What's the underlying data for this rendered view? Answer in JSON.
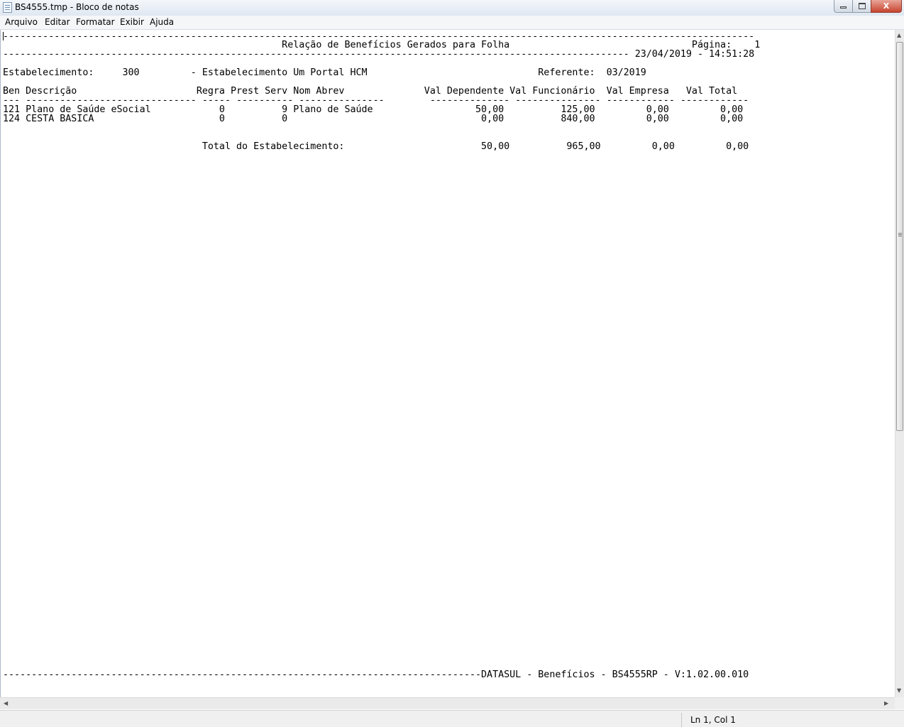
{
  "window": {
    "title": "BS4555.tmp - Bloco de notas",
    "minimize_glyph": "",
    "maximize_glyph": "",
    "close_glyph": "X"
  },
  "menu": [
    "Arquivo",
    "Editar",
    "Formatar",
    "Exibir",
    "Ajuda"
  ],
  "document": {
    "lines": [
      "------------------------------------------------------------------------------------------------------------------------------------",
      "                                                 Relação de Benefícios Gerados para Folha                                Página:    1",
      "-------------------------------------------------------------------------------------------------------------- 23/04/2019 - 14:51:28",
      "Estabelecimento:     300         - Estabelecimento Um Portal HCM                              Referente:  03/2019",
      "Ben Descrição                     Regra Prest Serv Nom Abrev              Val Dependente Val Funcionário  Val Empresa   Val Total",
      "--- ------------------------------ ----- ---------- ---------------        -------------- --------------- ------------ ------------",
      "121 Plano de Saúde eSocial            0          9 Plano de Saúde                  50,00          125,00         0,00         0,00",
      "124 CESTA BASICA                      0          0                                  0,00          840,00         0,00         0,00",
      "                                   Total do Estabelecimento:                        50,00          965,00         0,00         0,00",
      "------------------------------------------------------------------------------------DATASUL - Benefícios - BS4555RP - V:1.02.00.010"
    ]
  },
  "status": {
    "position": "Ln 1, Col 1"
  },
  "scrollbar": {
    "up": "▲",
    "down": "▼",
    "left": "◀",
    "right": "▶"
  }
}
